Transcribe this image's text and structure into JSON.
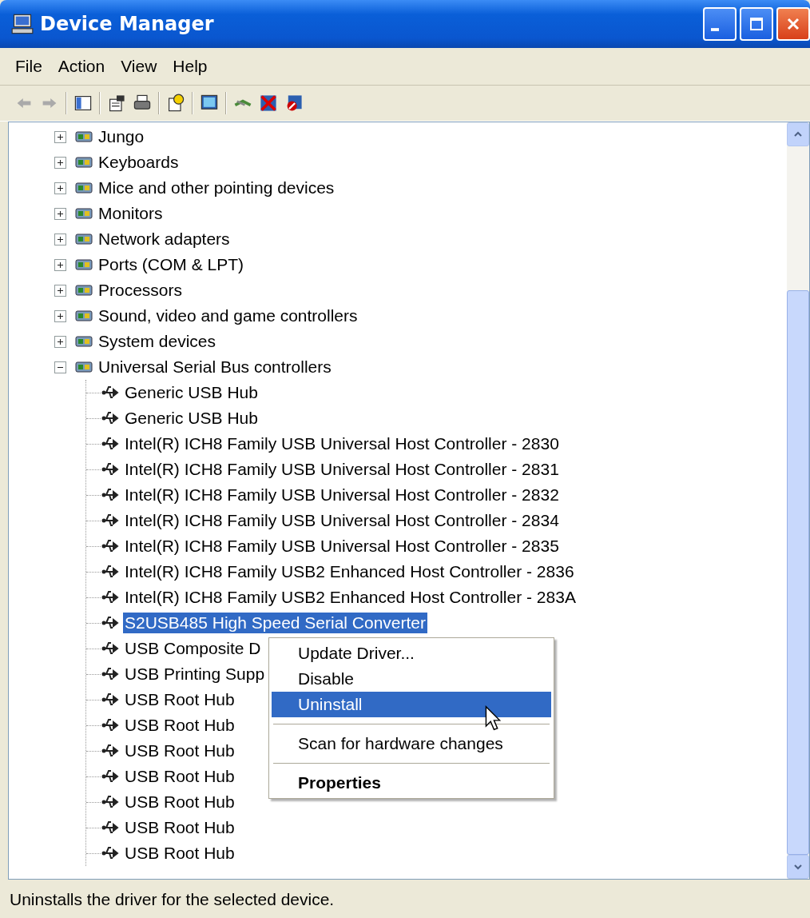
{
  "window": {
    "title": "Device Manager"
  },
  "menu_bar": [
    "File",
    "Action",
    "View",
    "Help"
  ],
  "toolbar": {
    "back": {
      "disabled": true
    },
    "forward": {
      "disabled": true
    }
  },
  "tree": [
    {
      "label": "Jungo",
      "expanded": false
    },
    {
      "label": "Keyboards",
      "expanded": false
    },
    {
      "label": "Mice and other pointing devices",
      "expanded": false
    },
    {
      "label": "Monitors",
      "expanded": false
    },
    {
      "label": "Network adapters",
      "expanded": false
    },
    {
      "label": "Ports (COM & LPT)",
      "expanded": false
    },
    {
      "label": "Processors",
      "expanded": false
    },
    {
      "label": "Sound, video and game controllers",
      "expanded": false
    },
    {
      "label": "System devices",
      "expanded": false
    },
    {
      "label": "Universal Serial Bus controllers",
      "expanded": true,
      "children": [
        {
          "label": "Generic USB Hub",
          "selected": false
        },
        {
          "label": "Generic USB Hub",
          "selected": false
        },
        {
          "label": "Intel(R) ICH8 Family USB Universal Host Controller - 2830",
          "selected": false
        },
        {
          "label": "Intel(R) ICH8 Family USB Universal Host Controller - 2831",
          "selected": false
        },
        {
          "label": "Intel(R) ICH8 Family USB Universal Host Controller - 2832",
          "selected": false
        },
        {
          "label": "Intel(R) ICH8 Family USB Universal Host Controller - 2834",
          "selected": false
        },
        {
          "label": "Intel(R) ICH8 Family USB Universal Host Controller - 2835",
          "selected": false
        },
        {
          "label": "Intel(R) ICH8 Family USB2 Enhanced Host Controller - 2836",
          "selected": false
        },
        {
          "label": "Intel(R) ICH8 Family USB2 Enhanced Host Controller - 283A",
          "selected": false
        },
        {
          "label": "S2USB485 High Speed Serial Converter",
          "selected": true
        },
        {
          "label": "USB Composite D",
          "selected": false
        },
        {
          "label": "USB Printing Supp",
          "selected": false
        },
        {
          "label": "USB Root Hub",
          "selected": false
        },
        {
          "label": "USB Root Hub",
          "selected": false
        },
        {
          "label": "USB Root Hub",
          "selected": false
        },
        {
          "label": "USB Root Hub",
          "selected": false
        },
        {
          "label": "USB Root Hub",
          "selected": false
        },
        {
          "label": "USB Root Hub",
          "selected": false
        },
        {
          "label": "USB Root Hub",
          "selected": false
        }
      ]
    }
  ],
  "context_menu": [
    {
      "kind": "item",
      "label": "Update Driver...",
      "selected": false,
      "default": false
    },
    {
      "kind": "item",
      "label": "Disable",
      "selected": false,
      "default": false
    },
    {
      "kind": "item",
      "label": "Uninstall",
      "selected": true,
      "default": false
    },
    {
      "kind": "separator"
    },
    {
      "kind": "item",
      "label": "Scan for hardware changes",
      "selected": false,
      "default": false
    },
    {
      "kind": "separator"
    },
    {
      "kind": "item",
      "label": "Properties",
      "selected": false,
      "default": true
    }
  ],
  "status_bar": "Uninstalls the driver for the selected device."
}
